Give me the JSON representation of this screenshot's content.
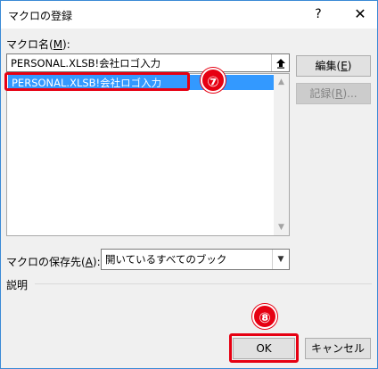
{
  "window": {
    "title": "マクロの登録",
    "help_glyph": "?",
    "close_glyph": "✕"
  },
  "macro_name": {
    "label_pre": "マクロ名(",
    "label_key": "M",
    "label_post": "):",
    "value": "PERSONAL.XLSB!会社ロゴ入力"
  },
  "macro_list": {
    "items": [
      "PERSONAL.XLSB!会社ロゴ入力"
    ]
  },
  "buttons": {
    "edit_pre": "編集(",
    "edit_key": "E",
    "edit_post": ")",
    "record_pre": "記録(",
    "record_key": "R",
    "record_post": ")...",
    "ok": "OK",
    "cancel": "キャンセル"
  },
  "save_location": {
    "label_pre": "マクロの保存先(",
    "label_key": "A",
    "label_post": "):",
    "selected": "開いているすべてのブック"
  },
  "description": {
    "label": "説明"
  },
  "annotations": {
    "step7": "⑦",
    "step8": "⑧"
  },
  "colors": {
    "selection": "#3399ff",
    "annotation_red": "#e60012",
    "window_border": "#3a8ad6"
  }
}
